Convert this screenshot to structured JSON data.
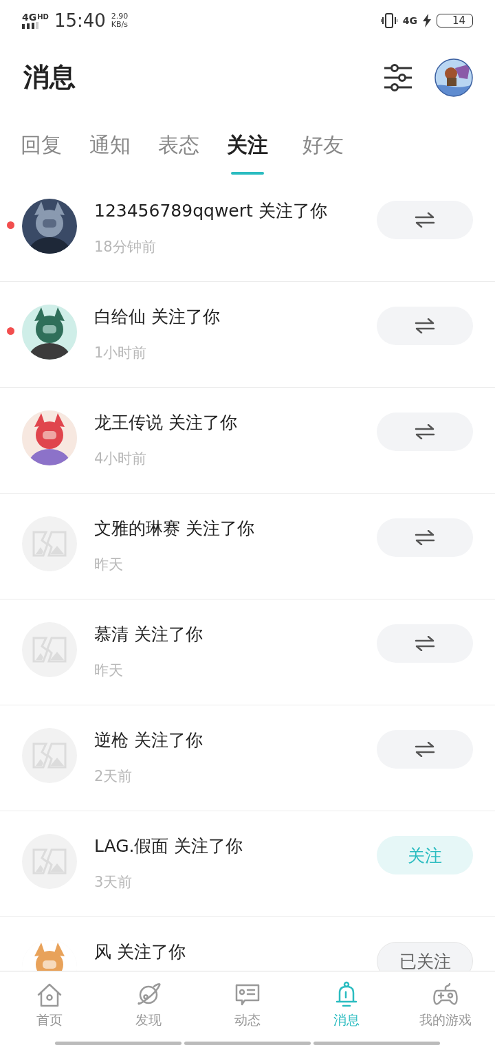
{
  "status_bar": {
    "network": "4G",
    "network_badge": "HD",
    "time": "15:40",
    "speed": "2.90",
    "speed_unit": "KB/s",
    "data_network": "4G",
    "battery": "14"
  },
  "header": {
    "title": "消息"
  },
  "tabs": [
    {
      "label": "回复",
      "selected": false
    },
    {
      "label": "通知",
      "selected": false
    },
    {
      "label": "表态",
      "selected": false
    },
    {
      "label": "关注",
      "selected": true
    },
    {
      "label": "好友",
      "selected": false
    }
  ],
  "items": [
    {
      "name": "123456789qqwert 关注了你",
      "time": "18分钟前",
      "unread": true,
      "button": {
        "kind": "mutual"
      }
    },
    {
      "name": "白给仙 关注了你",
      "time": "1小时前",
      "unread": true,
      "button": {
        "kind": "mutual"
      }
    },
    {
      "name": "龙王传说 关注了你",
      "time": "4小时前",
      "unread": false,
      "button": {
        "kind": "mutual"
      }
    },
    {
      "name": "文雅的琳赛 关注了你",
      "time": "昨天",
      "unread": false,
      "avatar": {
        "kind": "placeholder"
      },
      "button": {
        "kind": "mutual"
      }
    },
    {
      "name": "慕清 关注了你",
      "time": "昨天",
      "unread": false,
      "avatar": {
        "kind": "placeholder"
      },
      "button": {
        "kind": "mutual"
      }
    },
    {
      "name": "逆枪 关注了你",
      "time": "2天前",
      "unread": false,
      "avatar": {
        "kind": "placeholder"
      },
      "button": {
        "kind": "mutual"
      }
    },
    {
      "name": "LAG.假面 关注了你",
      "time": "3天前",
      "unread": false,
      "avatar": {
        "kind": "placeholder"
      },
      "button": {
        "kind": "follow",
        "label": "关注"
      }
    },
    {
      "name": "风 关注了你",
      "unread": false,
      "button": {
        "kind": "followed",
        "label": "已关注"
      }
    }
  ],
  "bottom_nav": [
    {
      "label": "首页",
      "kind": "home",
      "selected": false
    },
    {
      "label": "发现",
      "kind": "planet",
      "selected": false
    },
    {
      "label": "动态",
      "kind": "card",
      "selected": false
    },
    {
      "label": "消息",
      "kind": "bell",
      "selected": true
    },
    {
      "label": "我的游戏",
      "kind": "gamepad",
      "selected": false
    }
  ]
}
